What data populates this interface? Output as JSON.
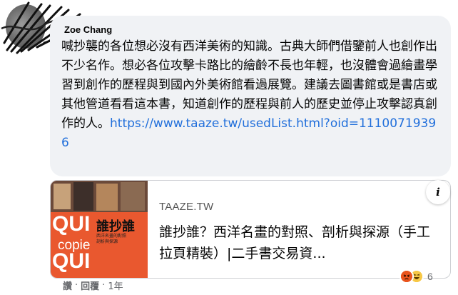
{
  "comment": {
    "author_name": "Zoe Chang",
    "text_before_link": "喊抄襲的各位想必沒有西洋美術的知識。古典大師們借鑒前人也創作出不少名作。想必各位攻擊卡路比的繪齡不長也年輕，也沒體會過繪畫學習到創作的歷程與到國內外美術館看過展覽。建議去圖書館或是書店或其他管道看看這本書，知道創作的歷程與前人的歷史並停止攻擊認真創作的人。",
    "link_text": "https://www.taaze.tw/usedList.html?oid=11100719396"
  },
  "link_preview": {
    "domain": "TAAZE.TW",
    "title": "誰抄誰？西洋名畫的對照、剖析與探源（手工拉頁精裝）|二手書交易資...",
    "thumbnail": {
      "word_top": "QUI",
      "word_middle": "copie",
      "word_bottom": "QUI",
      "cjk_title": "誰抄誰",
      "caption_1": "西洋名畫的對照",
      "caption_2": "剖析與探源"
    }
  },
  "actions": {
    "like": "讚",
    "separator": "·",
    "reply": "回覆",
    "time": "1年"
  },
  "reactions": {
    "icons": [
      "angry-emoji",
      "haha-emoji"
    ],
    "count": "6"
  },
  "info_button": {
    "glyph": "i"
  },
  "colors": {
    "bubble_bg": "#f0f2f5",
    "link": "#216fdb",
    "meta": "#65676b",
    "thumb_orange": "#e9582f"
  }
}
